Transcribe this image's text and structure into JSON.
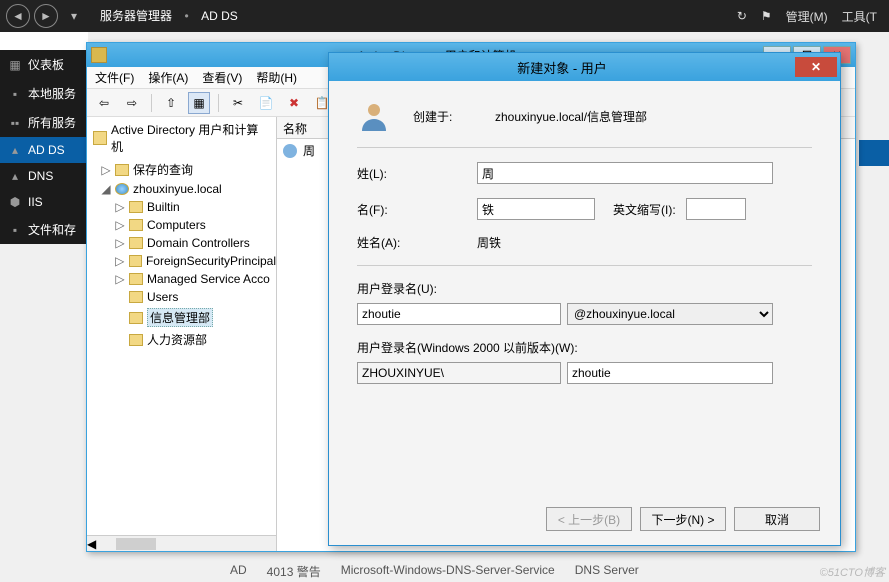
{
  "topbar": {
    "title_app": "服务器管理器",
    "title_section": "AD DS",
    "menu_manage": "管理(M)",
    "menu_tools": "工具(T"
  },
  "sidebar": {
    "items": [
      {
        "label": "仪表板",
        "icon": "dashboard-icon"
      },
      {
        "label": "本地服务",
        "icon": "local-server-icon"
      },
      {
        "label": "所有服务",
        "icon": "all-servers-icon"
      },
      {
        "label": "AD DS",
        "icon": "adds-icon",
        "active": true
      },
      {
        "label": "DNS",
        "icon": "dns-icon"
      },
      {
        "label": "IIS",
        "icon": "iis-icon"
      },
      {
        "label": "文件和存",
        "icon": "file-storage-icon"
      }
    ]
  },
  "mmc": {
    "title": "Active Directory 用户和计算机",
    "menus": {
      "file": "文件(F)",
      "action": "操作(A)",
      "view": "查看(V)",
      "help": "帮助(H)"
    },
    "tree": {
      "root": "Active Directory 用户和计算机",
      "saved_queries": "保存的查询",
      "domain": "zhouxinyue.local",
      "children": [
        "Builtin",
        "Computers",
        "Domain Controllers",
        "ForeignSecurityPrincipal",
        "Managed Service Acco",
        "Users",
        "信息管理部",
        "人力资源部"
      ],
      "selected": "信息管理部"
    },
    "list": {
      "col_name": "名称",
      "row1": "周"
    }
  },
  "dialog": {
    "title": "新建对象 - 用户",
    "created_in_label": "创建于:",
    "created_in_value": "zhouxinyue.local/信息管理部",
    "labels": {
      "surname": "姓(L):",
      "given": "名(F):",
      "initials": "英文缩写(I):",
      "fullname": "姓名(A):",
      "logon": "用户登录名(U):",
      "logon_pre": "用户登录名(Windows 2000 以前版本)(W):"
    },
    "values": {
      "surname": "周",
      "given": "铁",
      "initials": "",
      "fullname": "周铁",
      "logon": "zhoutie",
      "domain_suffix": "@zhouxinyue.local",
      "netbios": "ZHOUXINYUE\\",
      "samaccount": "zhoutie"
    },
    "buttons": {
      "back": "< 上一步(B)",
      "next": "下一步(N) >",
      "cancel": "取消"
    }
  },
  "bottom": {
    "c1": "AD",
    "c2": "4013   警告",
    "c3": "Microsoft‑Windows‑DNS‑Server‑Service",
    "c4": "DNS Server"
  },
  "watermark": "©51CTO博客"
}
